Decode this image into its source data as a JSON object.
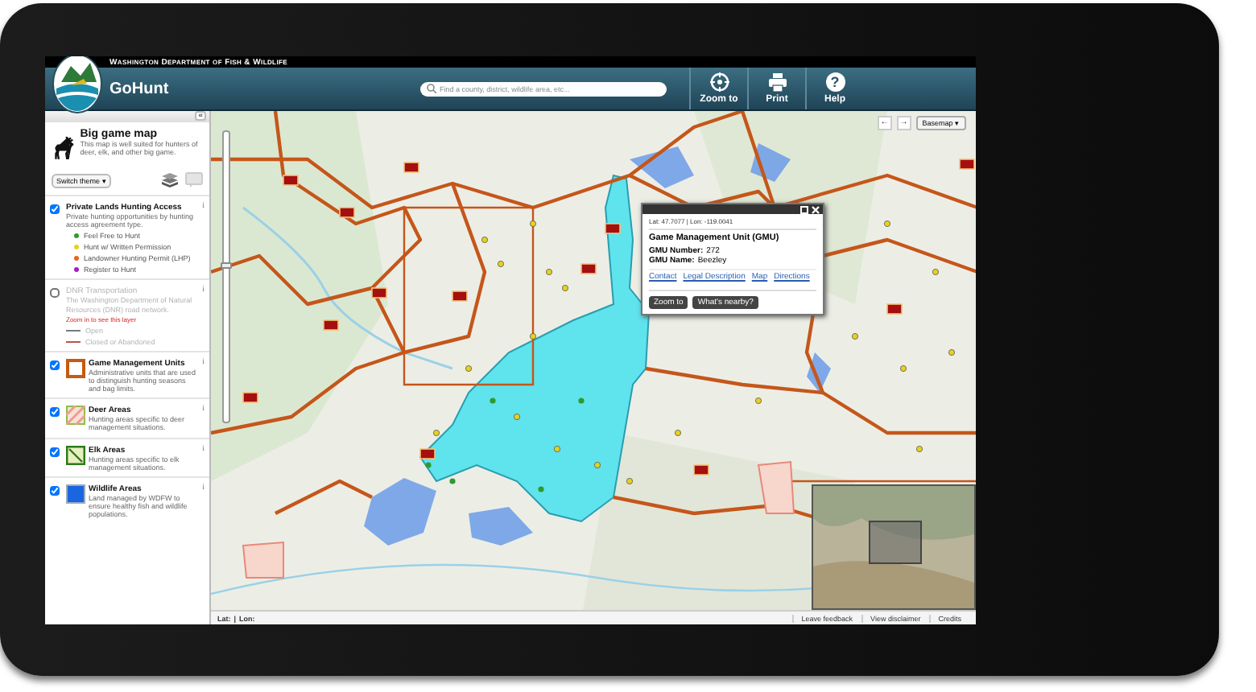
{
  "header": {
    "agency": "Washington Department of Fish & Wildlife",
    "app_title": "GoHunt",
    "search": {
      "placeholder": "Find a county, district, wildlife area, etc..."
    },
    "tools": [
      {
        "kind": "zoom",
        "label": "Zoom to"
      },
      {
        "kind": "print",
        "label": "Print"
      },
      {
        "kind": "help",
        "label": "Help",
        "icon": "?"
      }
    ]
  },
  "sidebar": {
    "collapse": "«",
    "theme": {
      "title": "Big game map",
      "description": "This map is well suited for hunters of deer, elk, and other big game."
    },
    "switch_button": "Switch theme ▾",
    "layers": [
      {
        "kind": "points",
        "checked": true,
        "disabled": false,
        "info": "i",
        "title": "Private Lands Hunting Access",
        "description": "Private hunting opportunities by hunting access agreement type.",
        "legend": [
          {
            "label": "Feel Free to Hunt",
            "color": "#2f9a2f"
          },
          {
            "label": "Hunt w/ Written Permission",
            "color": "#e6d21e"
          },
          {
            "label": "Landowner Hunting Permit (LHP)",
            "color": "#e8661c"
          },
          {
            "label": "Register to Hunt",
            "color": "#a020c0"
          }
        ]
      },
      {
        "kind": "lines",
        "checked": false,
        "disabled": true,
        "info": "i",
        "title": "DNR Transportation",
        "description": "The Washington Department of Natural Resources (DNR) road network.",
        "note": "Zoom in to see this layer",
        "legend": [
          {
            "label": "Open",
            "color": "#7a7a7a"
          },
          {
            "label": "Closed or Abandoned",
            "color": "#c0504d"
          }
        ]
      },
      {
        "kind": "outline",
        "checked": true,
        "disabled": false,
        "info": "i",
        "title": "Game Management Units",
        "description": "Administrative units that are used to distinguish hunting seasons and bag limits."
      },
      {
        "kind": "hatch",
        "checked": true,
        "disabled": false,
        "info": "i",
        "title": "Deer Areas",
        "description": "Hunting areas specific to deer management situations."
      },
      {
        "kind": "stripe",
        "checked": true,
        "disabled": false,
        "info": "i",
        "title": "Elk Areas",
        "description": "Hunting areas specific to elk management situations."
      },
      {
        "kind": "solid",
        "checked": true,
        "disabled": false,
        "info": "i",
        "title": "Wildlife Areas",
        "description": "Land managed by WDFW to ensure healthy fish and wildlife populations."
      }
    ]
  },
  "map": {
    "zoom_slider": {
      "level": 0.55
    },
    "back_button": "←",
    "forward_button": "→",
    "basemap_button": "Basemap ▾",
    "popup": {
      "coords": "Lat: 47.7077 | Lon: -119.0041",
      "title": "Game Management Unit (GMU)",
      "fields": [
        {
          "label": "GMU Number:",
          "value": "272"
        },
        {
          "label": "GMU Name:",
          "value": "Beezley"
        }
      ],
      "links": [
        "Contact",
        "Legal Description",
        "Map",
        "Directions"
      ],
      "buttons": [
        "Zoom to",
        "What's nearby?"
      ]
    },
    "status_bar": {
      "lat": "Lat:",
      "separator": "|",
      "lon": "Lon:",
      "links": [
        "Leave feedback",
        "View disclaimer",
        "Credits"
      ]
    }
  }
}
